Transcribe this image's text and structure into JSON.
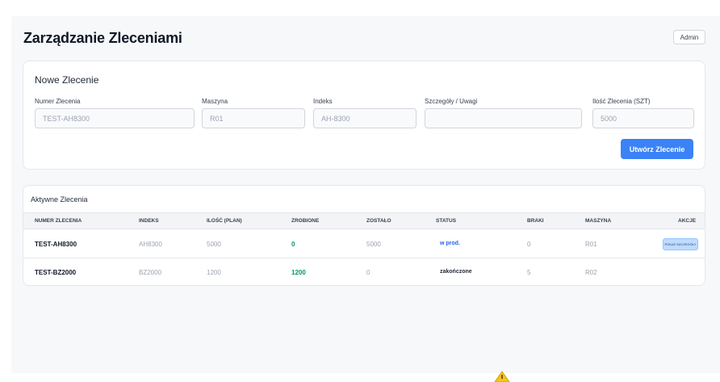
{
  "header": {
    "title": "Zarządzanie Zleceniami",
    "user_button": "Admin"
  },
  "new_order": {
    "title": "Nowe Zlecenie",
    "fields": [
      {
        "label": "Numer Zlecenia",
        "placeholder": "TEST-AH8300"
      },
      {
        "label": "Maszyna",
        "placeholder": "R01"
      },
      {
        "label": "Indeks",
        "placeholder": "AH-8300"
      },
      {
        "label": "Szczegóły / Uwagi",
        "placeholder": ""
      },
      {
        "label": "Ilość Zlecenia (SZT)",
        "placeholder": "5000"
      }
    ],
    "submit_label": "Utwórz Zlecenie"
  },
  "active_orders": {
    "title": "Aktywne Zlecenia",
    "columns": [
      "NUMER ZLECENIA",
      "INDEKS",
      "ILOŚĆ (PLAN)",
      "ZROBIONE",
      "ZOSTAŁO",
      "STATUS",
      "BRAKI",
      "MASZYNA",
      "AKCJE"
    ],
    "rows": [
      {
        "number": "TEST-AH8300",
        "index": "AH8300",
        "plan": "5000",
        "done": "0",
        "left": "5000",
        "status": "w prod.",
        "defects": "0",
        "machine": "R01",
        "action": "POKAŻ SZCZEGÓŁY"
      },
      {
        "number": "TEST-BZ2000",
        "index": "BZ2000",
        "plan": "1200",
        "done": "1200",
        "left": "0",
        "status": "zakończone",
        "defects": "5",
        "machine": "R02",
        "action": ""
      }
    ]
  },
  "colors": {
    "primary": "#3b82f6",
    "done_green": "#059669",
    "status_blue": "#2563eb",
    "warning": "#f5c518"
  },
  "icons": [
    "warning-icon"
  ]
}
